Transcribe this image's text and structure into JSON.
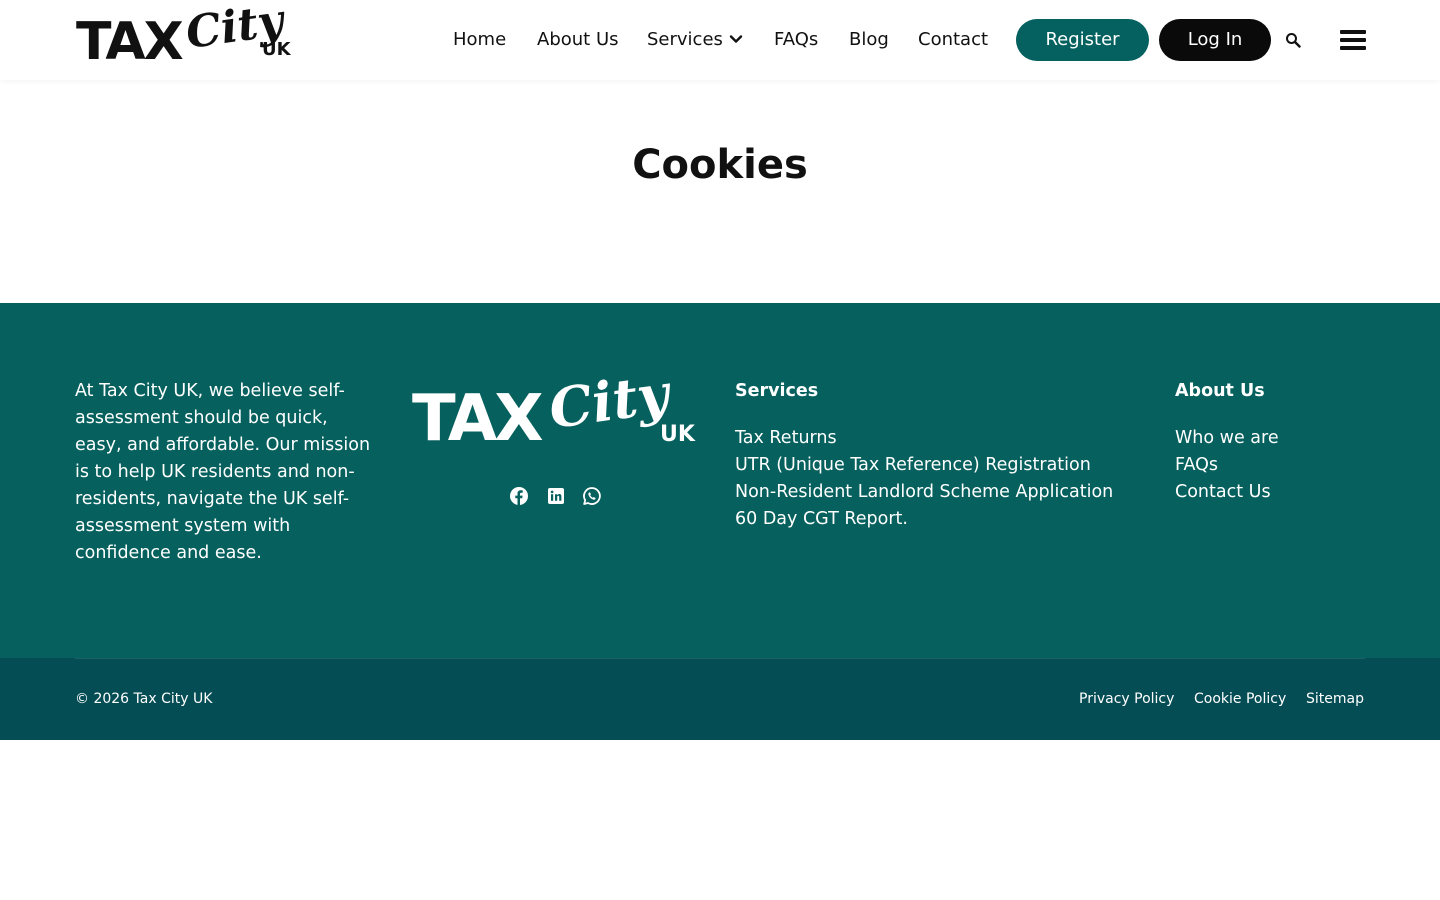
{
  "header": {
    "logo": {
      "main": "TAX",
      "script": "City",
      "suffix": "UK"
    },
    "nav": {
      "home": "Home",
      "about": "About Us",
      "services": "Services",
      "faqs": "FAQs",
      "blog": "Blog",
      "contact": "Contact"
    },
    "register_label": "Register",
    "login_label": "Log In"
  },
  "main": {
    "title": "Cookies"
  },
  "footer": {
    "about_text": "At Tax City UK, we believe self-assessment should be quick, easy, and affordable. Our mission is to help UK residents and non-residents, navigate the UK self-assessment system with confidence and ease.",
    "logo": {
      "main": "TAX",
      "script": "City",
      "suffix": "UK"
    },
    "social": [
      "facebook-icon",
      "linkedin-icon",
      "whatsapp-icon"
    ],
    "services": {
      "title": "Services",
      "links": [
        "Tax Returns",
        "UTR (Unique Tax Reference) Registration",
        "Non-Resident Landlord Scheme Application",
        "60 Day CGT Report."
      ]
    },
    "about": {
      "title": "About Us",
      "links": [
        "Who we are",
        "FAQs",
        "Contact Us"
      ]
    },
    "bottom": {
      "copyright": "© 2026 Tax City UK",
      "links": [
        "Privacy Policy",
        "Cookie Policy",
        "Sitemap"
      ]
    }
  },
  "colors": {
    "brand_teal": "#05605e",
    "bottom_bar": "#054d55",
    "register_button": "#04615f",
    "login_button": "#0a0a0a"
  }
}
